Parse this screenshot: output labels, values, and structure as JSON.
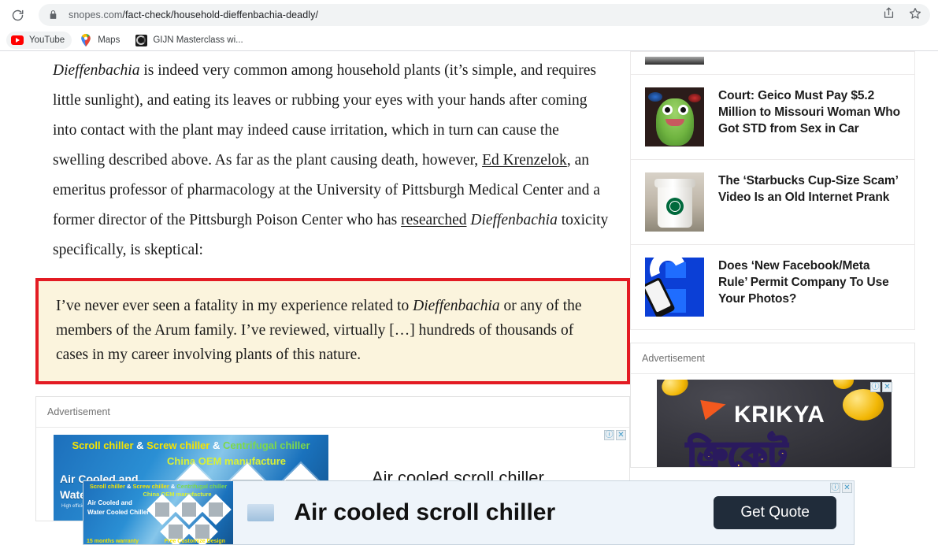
{
  "browser": {
    "reload_icon": "reload-icon",
    "lock_icon": "lock-icon",
    "url_host": "snopes.com",
    "url_path": "/fact-check/household-dieffenbachia-deadly/",
    "share_icon": "share-icon",
    "bookmark_star_icon": "star-icon",
    "bookmarks": [
      {
        "label": "YouTube",
        "icon": "youtube-icon",
        "hovered": true
      },
      {
        "label": "Maps",
        "icon": "google-maps-icon",
        "hovered": false
      },
      {
        "label": "GIJN Masterclass wi...",
        "icon": "gijn-icon",
        "hovered": false
      }
    ]
  },
  "article": {
    "paragraph_1": {
      "seg1_italic": "Dieffenbachia",
      "seg2": " is indeed very common among household plants (it’s simple, and requires little sunlight), and eating its leaves or rubbing your eyes with your hands after coming into contact with the plant may indeed cause irritation, which in turn can cause the swelling described above. As far as the plant causing death, however, ",
      "link1": "Ed Krenzelok",
      "seg3": ", an emeritus professor of pharmacology at the University of Pittsburgh Medical Center and a former director of the Pittsburgh Poison Center who has ",
      "link2": "researched",
      "seg4_space": " ",
      "seg5_italic": "Dieffenbachia",
      "seg6": " toxicity specifically, is skeptical:"
    },
    "quote": {
      "seg1": "I’ve never ever seen a fatality in my experience related to ",
      "seg2_italic": "Dieffenbachia",
      "seg3": " or any of the members of the Arum family. I’ve reviewed, virtually […] hundreds of thousands of cases in my career involving plants of this nature.",
      "border_color": "#e31b23",
      "background_color": "#fbf4dd"
    }
  },
  "sidebar": {
    "cards": [
      {
        "title": "",
        "thumb": "cropped-thumbnail",
        "partial": true
      },
      {
        "title": "Court: Geico Must Pay $5.2 Million to Missouri Woman Who Got STD from Sex in Car",
        "thumb": "geico-gecko-thumbnail",
        "partial": false
      },
      {
        "title": "The ‘Starbucks Cup-Size Scam’ Video Is an Old Internet Prank",
        "thumb": "starbucks-cup-thumbnail",
        "partial": false
      },
      {
        "title": "Does ‘New Facebook/Meta Rule’ Permit Company To Use Your Photos?",
        "thumb": "facebook-phone-thumbnail",
        "partial": false
      }
    ],
    "ad": {
      "label": "Advertisement",
      "brand": "KRIKYA",
      "bangla_text": "ক্রিকেট",
      "info_icon": "adchoices-info-icon",
      "close_icon": "adchoices-close-icon"
    }
  },
  "main_ad": {
    "label": "Advertisement",
    "creative": {
      "line1_a": "Scroll chiller",
      "line1_amp1": " & ",
      "line1_b": "Screw chiller",
      "line1_amp2": " & ",
      "line1_c": "Centrifugal chiller",
      "line2": "China OEM manufacture",
      "line3": "Air Cooled and\nWater Cooled Chiller",
      "line4": "High efficiency and reliability"
    },
    "headline": "Air cooled scroll chiller",
    "info_icon": "adchoices-info-icon",
    "close_icon": "adchoices-close-icon"
  },
  "sticky_ad": {
    "creative": {
      "line1_a": "Scroll chiller",
      "line1_amp1": " & ",
      "line1_b": "Screw chiller",
      "line1_amp2": " & ",
      "line1_c": "Centrifugal chiller",
      "line2": "China OEM manufacture",
      "line3": "Air Cooled and\nWater Cooled Chiller",
      "badge_left": "15 months warranty",
      "badge_right": "Free Customize Design"
    },
    "headline": "Air cooled scroll chiller",
    "cta_label": "Get Quote",
    "info_icon": "adchoices-info-icon",
    "close_icon": "adchoices-close-icon",
    "cta_color": "#202c3a"
  }
}
